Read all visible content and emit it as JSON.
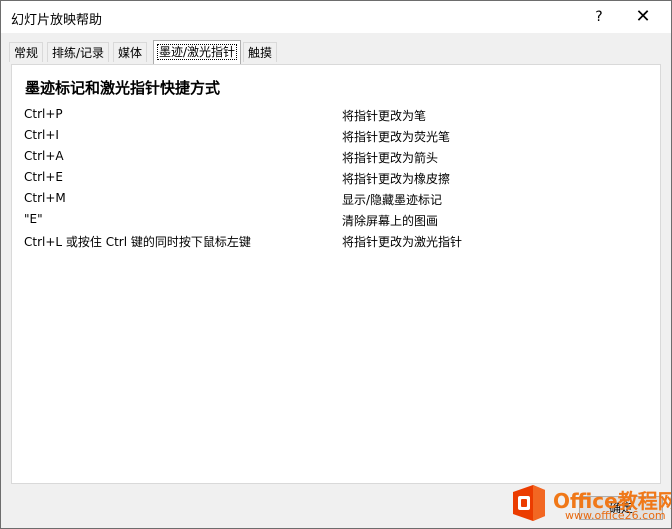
{
  "window": {
    "title": "幻灯片放映帮助",
    "help_label": "?",
    "close_label": "✕"
  },
  "tabs": [
    {
      "label": "常规"
    },
    {
      "label": "排练/记录"
    },
    {
      "label": "媒体"
    },
    {
      "label": "墨迹/激光指针"
    },
    {
      "label": "触摸"
    }
  ],
  "active_tab": "墨迹/激光指针",
  "panel": {
    "heading": "墨迹标记和激光指针快捷方式",
    "rows": [
      {
        "key": "Ctrl+P",
        "desc": "将指针更改为笔"
      },
      {
        "key": "Ctrl+I",
        "desc": "将指针更改为荧光笔"
      },
      {
        "key": "Ctrl+A",
        "desc": "将指针更改为箭头"
      },
      {
        "key": "Ctrl+E",
        "desc": "将指针更改为橡皮擦"
      },
      {
        "key": "Ctrl+M",
        "desc": "显示/隐藏墨迹标记"
      },
      {
        "key": "\"E\"",
        "desc": "清除屏幕上的图画"
      },
      {
        "key": "Ctrl+L 或按住 Ctrl 键的同时按下鼠标左键",
        "desc": "将指针更改为激光指针"
      }
    ]
  },
  "footer": {
    "ok_label": "确定"
  },
  "watermark": {
    "brand": "Office教程网",
    "url": "www.office26.com"
  },
  "colors": {
    "accent": "#f07818"
  }
}
